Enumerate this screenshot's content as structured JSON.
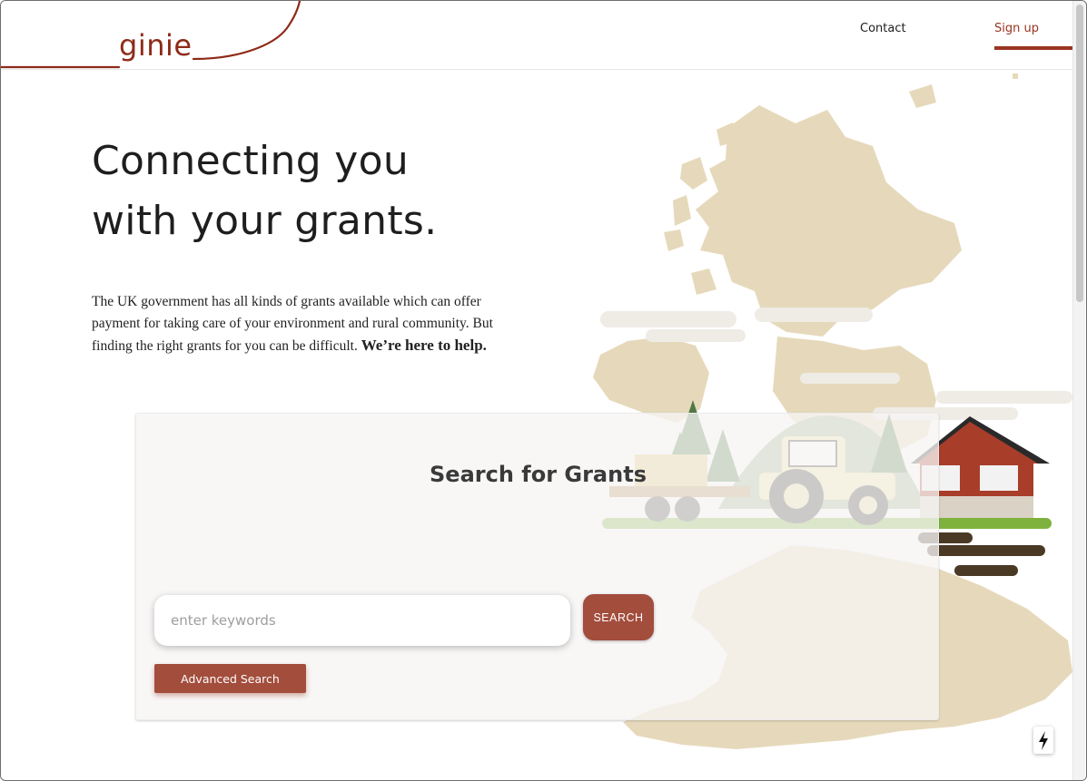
{
  "brand": {
    "name": "ginie",
    "accent": "#9a3420"
  },
  "nav": {
    "contact": "Contact",
    "signup": "Sign up"
  },
  "hero": {
    "line1": "Connecting you",
    "line2": "with your grants.",
    "intro": "The UK government has all kinds of grants available which can offer payment for taking care of your environment and rural community. But finding the right grants for you can be difficult.",
    "intro_bold": "We’re here to help."
  },
  "search": {
    "title": "Search for Grants",
    "placeholder": "enter keywords",
    "value": "",
    "button": "SEARCH",
    "advanced": "Advanced Search"
  },
  "colors": {
    "button": "#a34d3c",
    "map": "#e6d9bb",
    "barn": "#a83e2a"
  },
  "icons": {
    "floating": "lightning-bolt-icon"
  }
}
